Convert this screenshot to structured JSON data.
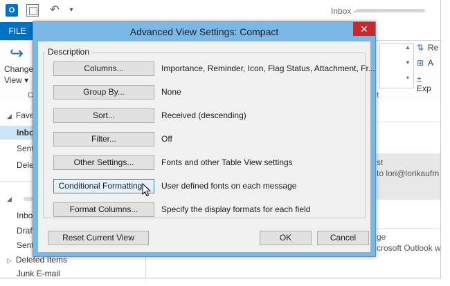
{
  "outlook": {
    "logo_text": "O",
    "window_title": "Inbox -",
    "file_tab": "FILE",
    "change_view_label_1": "Change",
    "change_view_label_2": "View ▾",
    "ribbon_group_label_left": "C",
    "ribbon_group_label_right": "t",
    "ribbon_right": [
      "Re",
      "A",
      "Exp"
    ],
    "nav": {
      "favorites": "Fave",
      "inbox": "Inbo",
      "sent": "Sent",
      "deleted": "Dele",
      "inbox2": "Inbo",
      "drafts": "Draf",
      "sent2": "Sent",
      "deleted_items": "Deleted Items",
      "junk": "Junk E-mail"
    },
    "messages": {
      "selected_subject": "st",
      "selected_from": "to lori@lorikaufm",
      "item2_subject": "ge",
      "item2_from": "crosoft Outlook w"
    }
  },
  "dialog": {
    "title": "Advanced View Settings: Compact",
    "close_glyph": "✕",
    "group_label": "Description",
    "rows": [
      {
        "button": "Columns...",
        "description": "Importance, Reminder, Icon, Flag Status, Attachment, Fr..."
      },
      {
        "button": "Group By...",
        "description": "None"
      },
      {
        "button": "Sort...",
        "description": "Received (descending)"
      },
      {
        "button": "Filter...",
        "description": "Off"
      },
      {
        "button": "Other Settings...",
        "description": "Fonts and other Table View settings"
      },
      {
        "button": "Conditional Formatting...",
        "description": "User defined fonts on each message"
      },
      {
        "button": "Format Columns...",
        "description": "Specify the display formats for each field"
      }
    ],
    "reset_button": "Reset Current View",
    "ok_button": "OK",
    "cancel_button": "Cancel"
  },
  "icons": {
    "undo": "undo-icon",
    "change_view": "change-view-icon",
    "cursor": "mouse-pointer-icon"
  },
  "colors": {
    "accent": "#0072c6",
    "dialog_frame": "#7ab8e8",
    "close_button": "#c7282b",
    "hover_button": "#e5f1fb"
  }
}
